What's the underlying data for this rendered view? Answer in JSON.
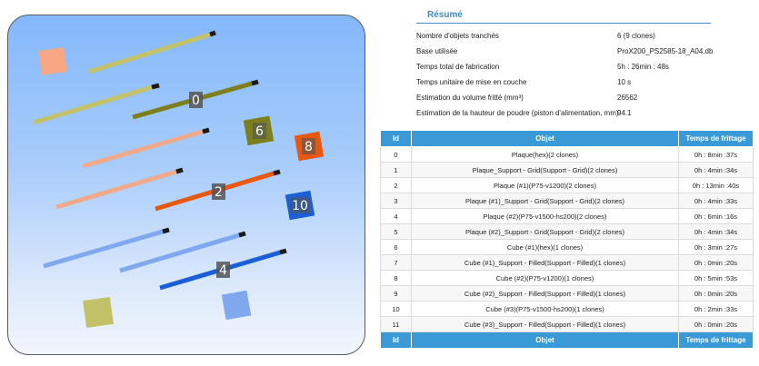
{
  "preview": {
    "id_labels": [
      "0",
      "2",
      "4",
      "6",
      "8",
      "10"
    ]
  },
  "summary": {
    "title": "Résumé",
    "rows": [
      {
        "label": "Nombre d'objets tranchés",
        "value": "6 (9 clones)"
      },
      {
        "label": "Base utilisée",
        "value": "ProX200_PS2585-18_A04.db"
      },
      {
        "label": "Temps total de fabrication",
        "value": "5h : 26min : 48s"
      },
      {
        "label": "Temps unitaire de mise en couche",
        "value": "10 s"
      },
      {
        "label": "Estimation du volume fritté (mm³)",
        "value": "26562"
      },
      {
        "label": "Estimation de la hauteur de poudre (piston d'alimentation, mm)",
        "value": "94.1"
      }
    ]
  },
  "table": {
    "headers": {
      "id": "Id",
      "objet": "Objet",
      "temps": "Temps de frittage"
    },
    "rows": [
      {
        "id": "0",
        "objet": "Plaque(hex)(2 clones)",
        "temps": "0h : 8min :37s"
      },
      {
        "id": "1",
        "objet": "Plaque_Support - Grid(Support - Grid)(2 clones)",
        "temps": "0h : 4min :34s"
      },
      {
        "id": "2",
        "objet": "Plaque (#1)(P75-v1200)(2 clones)",
        "temps": "0h : 13min :40s"
      },
      {
        "id": "3",
        "objet": "Plaque (#1)_Support - Grid(Support - Grid)(2 clones)",
        "temps": "0h : 4min :33s"
      },
      {
        "id": "4",
        "objet": "Plaque (#2)(P75-v1500-hs200)(2 clones)",
        "temps": "0h : 6min :16s"
      },
      {
        "id": "5",
        "objet": "Plaque (#2)_Support - Grid(Support - Grid)(2 clones)",
        "temps": "0h : 4min :34s"
      },
      {
        "id": "6",
        "objet": "Cube (#1)(hex)(1 clones)",
        "temps": "0h : 3min :27s"
      },
      {
        "id": "7",
        "objet": "Cube (#1)_Support - Filled(Support - Filled)(1 clones)",
        "temps": "0h : 0min :20s"
      },
      {
        "id": "8",
        "objet": "Cube (#2)(P75-v1200)(1 clones)",
        "temps": "0h : 5min :53s"
      },
      {
        "id": "9",
        "objet": "Cube (#2)_Support - Filled(Support - Filled)(1 clones)",
        "temps": "0h : 0min :20s"
      },
      {
        "id": "10",
        "objet": "Cube (#3)(P75-v1500-hs200)(1 clones)",
        "temps": "0h : 2min :33s"
      },
      {
        "id": "11",
        "objet": "Cube (#3)_Support - Filled(Support - Filled)(1 clones)",
        "temps": "0h : 0min :20s"
      }
    ]
  }
}
